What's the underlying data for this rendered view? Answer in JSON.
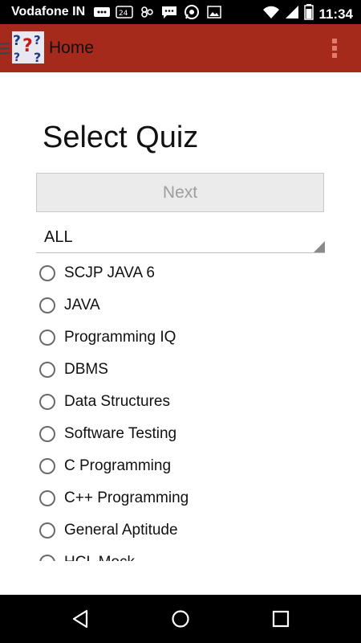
{
  "status_bar": {
    "carrier": "Vodafone IN",
    "time": "11:34",
    "icons": [
      "bbm-icon",
      "data-24-icon",
      "app-88-icon",
      "chat-icon",
      "whatsapp-icon",
      "image-icon",
      "wifi-icon",
      "signal-icon",
      "battery-icon"
    ]
  },
  "app_bar": {
    "title": "Home"
  },
  "main": {
    "heading": "Select Quiz",
    "next_label": "Next",
    "filter_value": "ALL",
    "quizzes": [
      "SCJP JAVA 6",
      "JAVA",
      "Programming IQ",
      "DBMS",
      "Data Structures",
      "Software Testing",
      "C Programming",
      "C++ Programming",
      "General Aptitude",
      "HCL Mock"
    ]
  },
  "colors": {
    "app_bar": "#a52a1c",
    "button_bg": "#ebebeb",
    "button_text": "#9e9e9e"
  }
}
